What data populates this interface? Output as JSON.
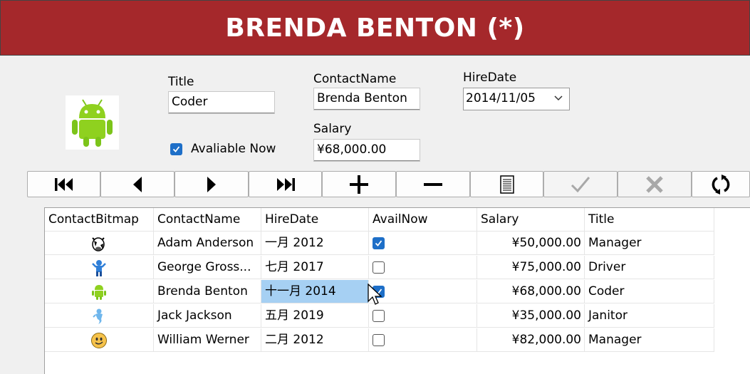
{
  "header": {
    "title": "BRENDA BENTON (*)"
  },
  "form": {
    "title_label": "Title",
    "title_value": "Coder",
    "contact_label": "ContactName",
    "contact_value": "Brenda Benton",
    "hire_label": "HireDate",
    "hire_value": "2014/11/05",
    "salary_label": "Salary",
    "salary_value": "¥68,000.00",
    "available_label": "Avaliable Now",
    "available_checked": true
  },
  "toolbar": {
    "buttons": [
      "first-record",
      "previous-record",
      "next-record",
      "last-record",
      "add-record",
      "delete-record",
      "edit-record",
      "save-record",
      "cancel-edit",
      "refresh"
    ]
  },
  "grid": {
    "columns": [
      "ContactBitmap",
      "ContactName",
      "HireDate",
      "AvailNow",
      "Salary",
      "Title"
    ],
    "rows": [
      {
        "icon": "cow-icon",
        "name": "Adam Anderson",
        "hire": "一月 2012",
        "avail": true,
        "salary": "¥50,000.00",
        "title": "Manager"
      },
      {
        "icon": "blue-figure-icon",
        "name": "George Gross...",
        "hire": "七月 2017",
        "avail": false,
        "salary": "¥75,000.00",
        "title": "Driver"
      },
      {
        "icon": "android-icon",
        "name": "Brenda Benton",
        "hire": "十一月 2014",
        "avail": true,
        "salary": "¥68,000.00",
        "title": "Coder"
      },
      {
        "icon": "genie-icon",
        "name": "Jack Jackson",
        "hire": "五月 2019",
        "avail": false,
        "salary": "¥35,000.00",
        "title": "Janitor"
      },
      {
        "icon": "smiley-icon",
        "name": "William Werner",
        "hire": "二月 2012",
        "avail": false,
        "salary": "¥82,000.00",
        "title": "Manager"
      }
    ]
  },
  "colors": {
    "header_bg": "#a5282b",
    "accent": "#1e6fc8",
    "selection": "#a6d0f3"
  }
}
